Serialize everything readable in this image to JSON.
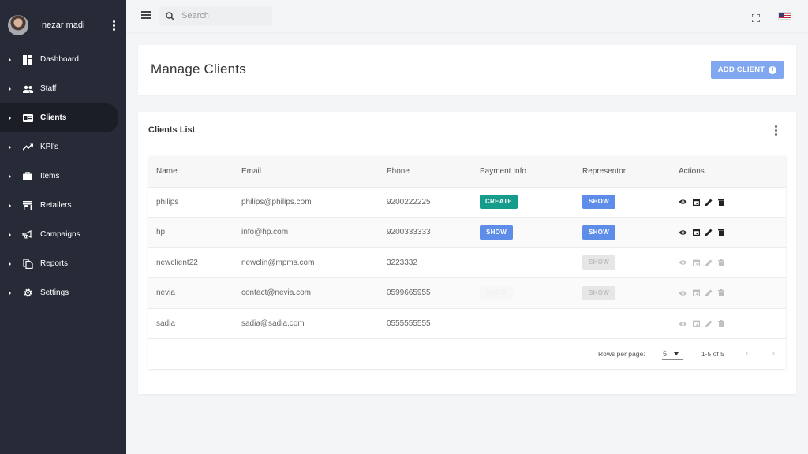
{
  "colors": {
    "sidebar_bg": "#262b37",
    "accent_blue": "#5d8de8",
    "add_button": "#80a7ef",
    "create_green": "#169c8a"
  },
  "profile": {
    "name": "nezar madi"
  },
  "sidebar": {
    "items": [
      {
        "label": "Dashboard",
        "icon": "dashboard-icon"
      },
      {
        "label": "Staff",
        "icon": "people-icon"
      },
      {
        "label": "Clients",
        "icon": "id-card-icon",
        "active": true
      },
      {
        "label": "KPI's",
        "icon": "trending-up-icon"
      },
      {
        "label": "Items",
        "icon": "briefcase-icon"
      },
      {
        "label": "Retailers",
        "icon": "store-icon"
      },
      {
        "label": "Campaigns",
        "icon": "megaphone-icon"
      },
      {
        "label": "Reports",
        "icon": "documents-icon"
      },
      {
        "label": "Settings",
        "icon": "gear-icon"
      }
    ]
  },
  "topbar": {
    "search_placeholder": "Search"
  },
  "header": {
    "title": "Manage Clients",
    "add_label": "ADD CLIENT"
  },
  "list": {
    "title": "Clients List",
    "columns": [
      "Name",
      "Email",
      "Phone",
      "Payment Info",
      "Representor",
      "Actions"
    ],
    "rows": [
      {
        "name": "philips",
        "email": "philips@philips.com",
        "phone": "9200222225",
        "payment": "CREATE",
        "representor": "SHOW"
      },
      {
        "name": "hp",
        "email": "info@hp.com",
        "phone": "9200333333",
        "payment": "SHOW",
        "representor": "SHOW"
      },
      {
        "name": "newclient22",
        "email": "newclin@mpms.com",
        "phone": "3223332",
        "payment": "",
        "representor": "SHOW"
      },
      {
        "name": "nevia",
        "email": "contact@nevia.com",
        "phone": "0599665955",
        "payment": "SHOW",
        "representor": "SHOW"
      },
      {
        "name": "sadia",
        "email": "sadia@sadia.com",
        "phone": "0555555555",
        "payment": "",
        "representor": ""
      }
    ]
  },
  "pagination": {
    "rows_per_page_label": "Rows per page:",
    "rows_per_page": "5",
    "range": "1-5 of 5"
  }
}
